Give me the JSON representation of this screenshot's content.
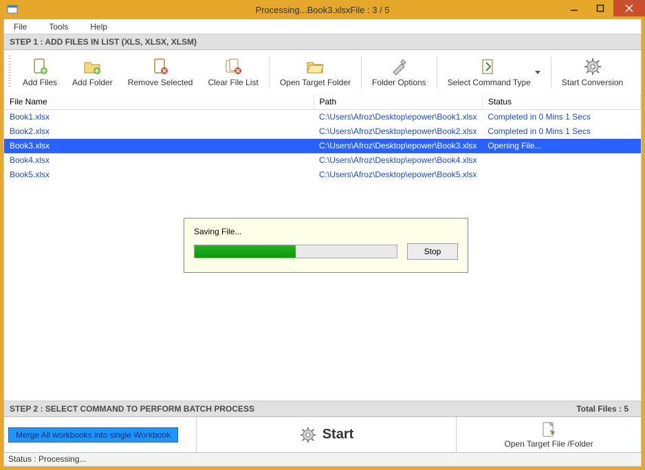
{
  "title": "Processing...Book3.xlsxFile : 3 / 5",
  "menus": {
    "file": "File",
    "tools": "Tools",
    "help": "Help"
  },
  "step1_header": "STEP 1 : ADD FILES IN LIST (XLS, XLSX, XLSM)",
  "toolbar": {
    "add_files": "Add Files",
    "add_folder": "Add Folder",
    "remove_selected": "Remove Selected",
    "clear_list": "Clear File List",
    "open_target": "Open Target Folder",
    "folder_options": "Folder Options",
    "select_command": "Select Command Type",
    "start_conversion": "Start Conversion"
  },
  "columns": {
    "name": "File Name",
    "path": "Path",
    "status": "Status"
  },
  "rows": [
    {
      "name": "Book1.xlsx",
      "path": "C:\\Users\\Afroz\\Desktop\\epower\\Book1.xlsx",
      "status": "Completed in 0 Mins 1 Secs",
      "selected": false
    },
    {
      "name": "Book2.xlsx",
      "path": "C:\\Users\\Afroz\\Desktop\\epower\\Book2.xlsx",
      "status": "Completed in 0 Mins 1 Secs",
      "selected": false
    },
    {
      "name": "Book3.xlsx",
      "path": "C:\\Users\\Afroz\\Desktop\\epower\\Book3.xlsx",
      "status": "Opening File...",
      "selected": true
    },
    {
      "name": "Book4.xlsx",
      "path": "C:\\Users\\Afroz\\Desktop\\epower\\Book4.xlsx",
      "status": "",
      "selected": false
    },
    {
      "name": "Book5.xlsx",
      "path": "C:\\Users\\Afroz\\Desktop\\epower\\Book5.xlsx",
      "status": "",
      "selected": false
    }
  ],
  "dialog": {
    "label": "Saving File...",
    "progress_pct": 50,
    "stop": "Stop"
  },
  "step2_header": "STEP 2 : SELECT COMMAND TO PERFORM BATCH PROCESS",
  "total_files": "Total Files : 5",
  "commands": {
    "merge": "Merge All workbooks into single Workbook",
    "start": "Start",
    "open_target": "Open Target File /Folder"
  },
  "statusbar": "Status  :  Processing..."
}
